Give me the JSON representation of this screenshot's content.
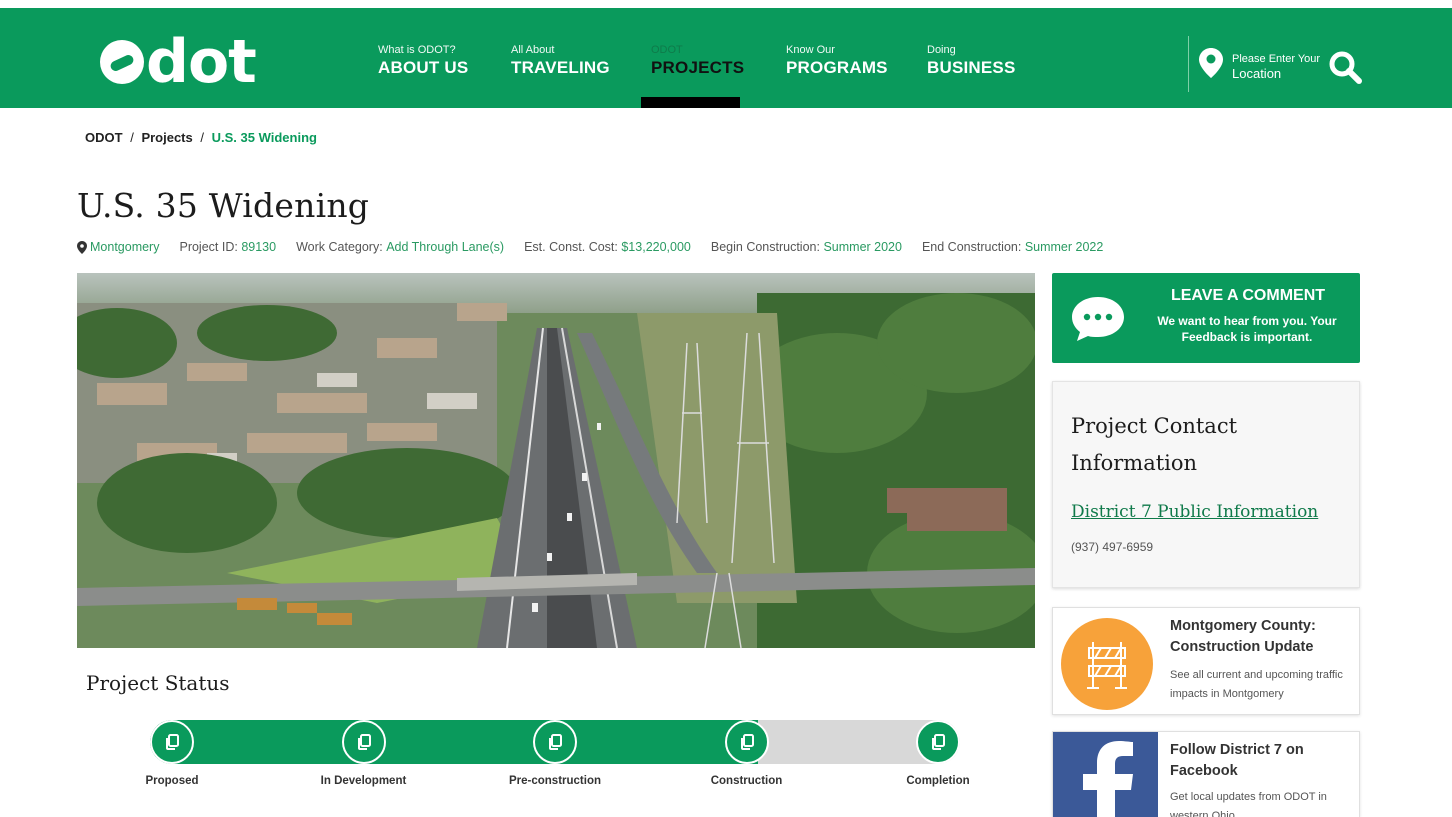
{
  "header": {
    "logo_text": "dot",
    "nav": [
      {
        "small": "What is ODOT?",
        "big": "ABOUT US"
      },
      {
        "small": "All About",
        "big": "TRAVELING"
      },
      {
        "small": "ODOT",
        "big": "PROJECTS"
      },
      {
        "small": "Know Our",
        "big": "PROGRAMS"
      },
      {
        "small": "Doing",
        "big": "BUSINESS"
      }
    ],
    "active_nav": "PROJECTS",
    "location": {
      "small": "Please Enter Your",
      "big": "Location"
    },
    "icons": {
      "location": "map-pin-icon",
      "search": "search-icon"
    },
    "colors": {
      "brand_green": "#0a9a5c",
      "active_indicator": "#000000"
    }
  },
  "breadcrumb": {
    "items": [
      "ODOT",
      "Projects",
      "U.S. 35 Widening"
    ],
    "separator": "/"
  },
  "project": {
    "title": "U.S. 35 Widening",
    "county": "Montgomery",
    "id_label": "Project ID:",
    "id_value": "89130",
    "category_label": "Work Category:",
    "category_value": "Add Through Lane(s)",
    "cost_label": "Est. Const. Cost:",
    "cost_value": "$13,220,000",
    "begin_label": "Begin Construction:",
    "begin_value": "Summer 2020",
    "end_label": "End Construction:",
    "end_value": "Summer 2022"
  },
  "status": {
    "title": "Project Status",
    "stages": [
      "Proposed",
      "In Development",
      "Pre-construction",
      "Construction",
      "Completion"
    ],
    "progress_fraction": 0.75,
    "colors": {
      "complete": "#0a9a5c",
      "incomplete": "#d8d8d8"
    },
    "icon": "copy-document-icon"
  },
  "sidebar": {
    "comment": {
      "title": "LEAVE A COMMENT",
      "subtitle": "We want to hear from you. Your Feedback is important.",
      "icon": "chat-bubble-icon"
    },
    "contact": {
      "title": "Project Contact Information",
      "link": "District 7 Public Information",
      "phone": "(937) 497-6959"
    },
    "promos": [
      {
        "title": "Montgomery County: Construction Update",
        "desc": "See all current and upcoming traffic impacts in Montgomery",
        "icon": "road-barrier-icon"
      },
      {
        "title": "Follow District 7 on Facebook",
        "desc": "Get local updates from ODOT in western Ohio",
        "icon": "facebook-icon"
      }
    ]
  }
}
